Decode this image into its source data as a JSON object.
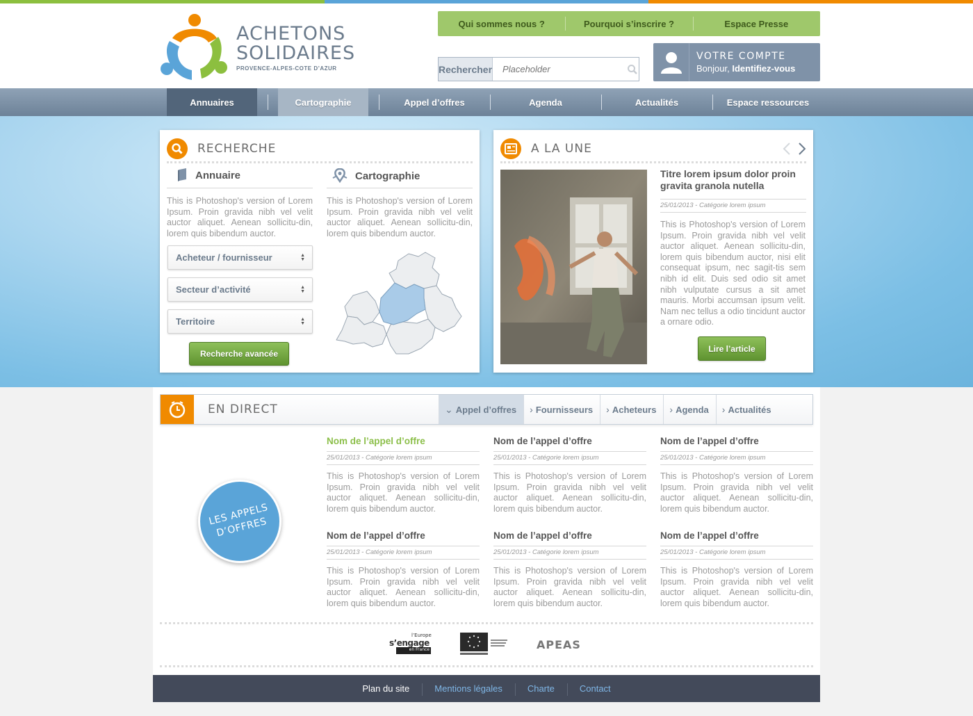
{
  "colors": {
    "strip": [
      "#8cbf3f",
      "#5aa4d8",
      "#f08a00"
    ],
    "green": "#9fc86b",
    "orange": "#f08a00",
    "blue": "#5aa4d8",
    "slate": "#7f92a8",
    "footer": "#434a5a"
  },
  "brand": {
    "line1": "ACHETONS",
    "line2": "SOLIDAIRES",
    "region": "PROVENCE-ALPES-COTE D’AZUR"
  },
  "topnav": [
    {
      "label": "Qui sommes nous ?"
    },
    {
      "label": "Pourquoi s’inscrire ?"
    },
    {
      "label": "Espace Presse"
    }
  ],
  "search": {
    "label": "Rechercher",
    "placeholder": "Placeholder",
    "icon": "magnifier-icon"
  },
  "account": {
    "title": "VOTRE COMPTE",
    "greeting": "Bonjour,",
    "action": "Identifiez-vous",
    "icon": "user-icon"
  },
  "mainnav": [
    {
      "label": "Annuaires",
      "state": "active"
    },
    {
      "label": "Cartographie",
      "state": "hover"
    },
    {
      "label": "Appel d’offres"
    },
    {
      "label": "Agenda"
    },
    {
      "label": "Actualités"
    },
    {
      "label": "Espace ressources"
    }
  ],
  "recherche": {
    "title": "RECHERCHE",
    "annuaire": {
      "title": "Annuaire",
      "text": "This is Photoshop's version of Lorem Ipsum. Proin gravida nibh vel velit auctor aliquet. Aenean sollicitu-din, lorem quis bibendum auctor."
    },
    "cartographie": {
      "title": "Cartographie",
      "text": "This is Photoshop's version of Lorem Ipsum. Proin gravida nibh vel velit auctor aliquet. Aenean sollicitu-din, lorem quis bibendum auctor."
    },
    "selects": [
      {
        "value": "Acheteur / fournisseur"
      },
      {
        "value": "Secteur d’activité"
      },
      {
        "value": "Territoire"
      }
    ],
    "button": "Recherche avancée"
  },
  "une": {
    "title": "A LA UNE",
    "article_title": "Titre lorem ipsum dolor proin gravita granola nutella",
    "meta": "25/01/2013 - Catégorie lorem ipsum",
    "text": "This is Photoshop's version of Lorem Ipsum. Proin gravida nibh vel velit auctor aliquet. Aenean sollicitu-din, lorem quis bibendum auctor, nisi elit consequat ipsum, nec sagit-tis sem nibh id elit. Duis sed odio sit amet nibh vulputate cursus a sit amet mauris. Morbi accumsan ipsum velit. Nam nec tellus a odio tincidunt auctor a ornare odio.",
    "button": "Lire l’article"
  },
  "direct": {
    "title": "EN DIRECT",
    "tabs": [
      {
        "label": "Appel d’offres",
        "active": true
      },
      {
        "label": "Fournisseurs"
      },
      {
        "label": "Acheteurs"
      },
      {
        "label": "Agenda"
      },
      {
        "label": "Actualités"
      }
    ],
    "badge": [
      "LES APPELS",
      "D’OFFRES"
    ],
    "offers": [
      {
        "name": "Nom de l’appel d’offre",
        "meta": "25/01/2013 - Catégorie lorem ipsum",
        "text": "This is Photoshop's version of Lorem Ipsum. Proin gravida nibh vel velit auctor aliquet. Aenean sollicitu-din, lorem quis bibendum auctor.",
        "highlight": true
      },
      {
        "name": "Nom de l’appel d’offre",
        "meta": "25/01/2013 - Catégorie lorem ipsum",
        "text": "This is Photoshop's version of Lorem Ipsum. Proin gravida nibh vel velit auctor aliquet. Aenean sollicitu-din, lorem quis bibendum auctor."
      },
      {
        "name": "Nom de l’appel d’offre",
        "meta": "25/01/2013 - Catégorie lorem ipsum",
        "text": "This is Photoshop's version of Lorem Ipsum. Proin gravida nibh vel velit auctor aliquet. Aenean sollicitu-din, lorem quis bibendum auctor."
      },
      {
        "name": "Nom de l’appel d’offre",
        "meta": "25/01/2013 - Catégorie lorem ipsum",
        "text": "This is Photoshop's version of Lorem Ipsum. Proin gravida nibh vel velit auctor aliquet. Aenean sollicitu-din, lorem quis bibendum auctor."
      },
      {
        "name": "Nom de l’appel d’offre",
        "meta": "25/01/2013 - Catégorie lorem ipsum",
        "text": "This is Photoshop's version of Lorem Ipsum. Proin gravida nibh vel velit auctor aliquet. Aenean sollicitu-din, lorem quis bibendum auctor."
      },
      {
        "name": "Nom de l’appel d’offre",
        "meta": "25/01/2013 - Catégorie lorem ipsum",
        "text": "This is Photoshop's version of Lorem Ipsum. Proin gravida nibh vel velit auctor aliquet. Aenean sollicitu-din, lorem quis bibendum auctor."
      }
    ]
  },
  "partners": {
    "europe": {
      "line1": "l’Europe",
      "line2": "s’engage",
      "line3": "en France"
    },
    "apeas": "APEAS"
  },
  "footer": [
    {
      "label": "Plan du site",
      "current": true
    },
    {
      "label": "Mentions légales"
    },
    {
      "label": "Charte"
    },
    {
      "label": "Contact"
    }
  ]
}
